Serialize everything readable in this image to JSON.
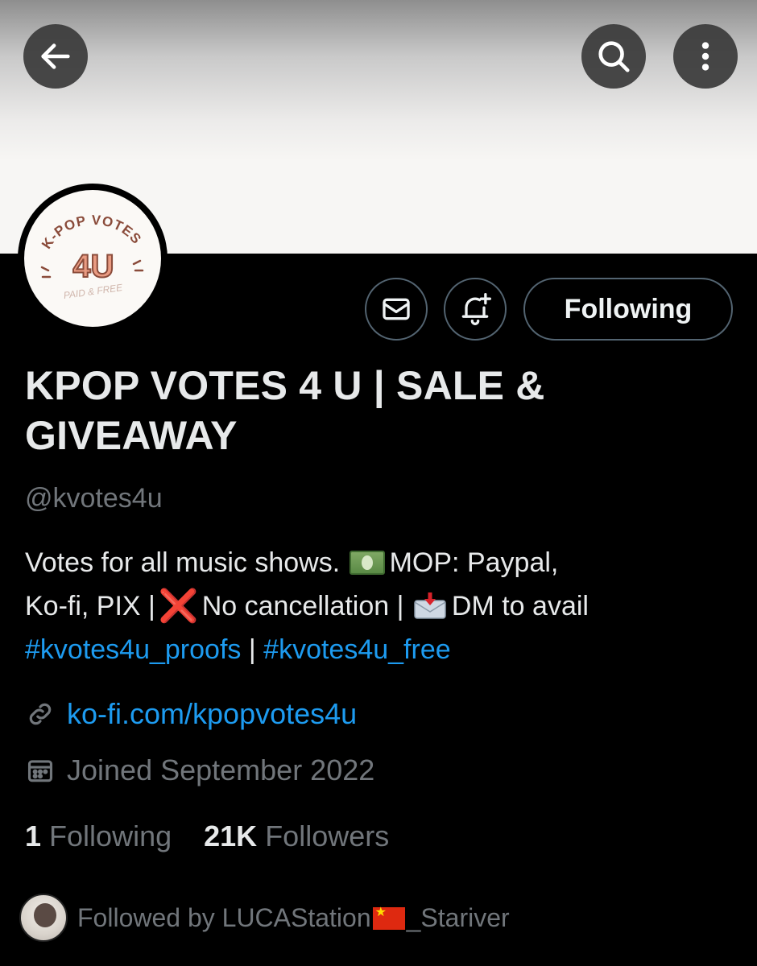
{
  "header": {
    "back_icon": "arrow-left-icon",
    "search_icon": "search-icon",
    "more_icon": "more-vertical-icon"
  },
  "avatar": {
    "logo_top_text": "K-POP VOTES",
    "logo_main_text": "4U",
    "logo_sub_text": "PAID & FREE"
  },
  "actions": {
    "message_icon": "envelope-icon",
    "notify_icon": "bell-plus-icon",
    "following_label": "Following"
  },
  "profile": {
    "display_name_line1": "KPOP VOTES 4 U | SALE &",
    "display_name_line2": "GIVEAWAY",
    "handle": "@kvotes4u",
    "bio": {
      "line1_text": "Votes for all music shows.",
      "line1_text2": "MOP: Paypal,",
      "line2_text": "Ko-fi, PIX |",
      "line2_x": "❌",
      "line2_text2": "No cancellation |",
      "line2_text3": "DM to avail",
      "tag1": "#kvotes4u_proofs",
      "separator": "|",
      "tag2": "#kvotes4u_free"
    },
    "link": "ko-fi.com/kpopvotes4u",
    "joined": "Joined September 2022"
  },
  "stats": {
    "following_count": "1",
    "following_label": "Following",
    "followers_count": "21K",
    "followers_label": "Followers"
  },
  "followed_by": {
    "prefix": "Followed by LUCAStation",
    "suffix": "_Stariver"
  },
  "colors": {
    "background": "#000000",
    "text": "#e7e9ea",
    "secondary": "#71767b",
    "link": "#1d9bf0",
    "border": "#536471"
  }
}
